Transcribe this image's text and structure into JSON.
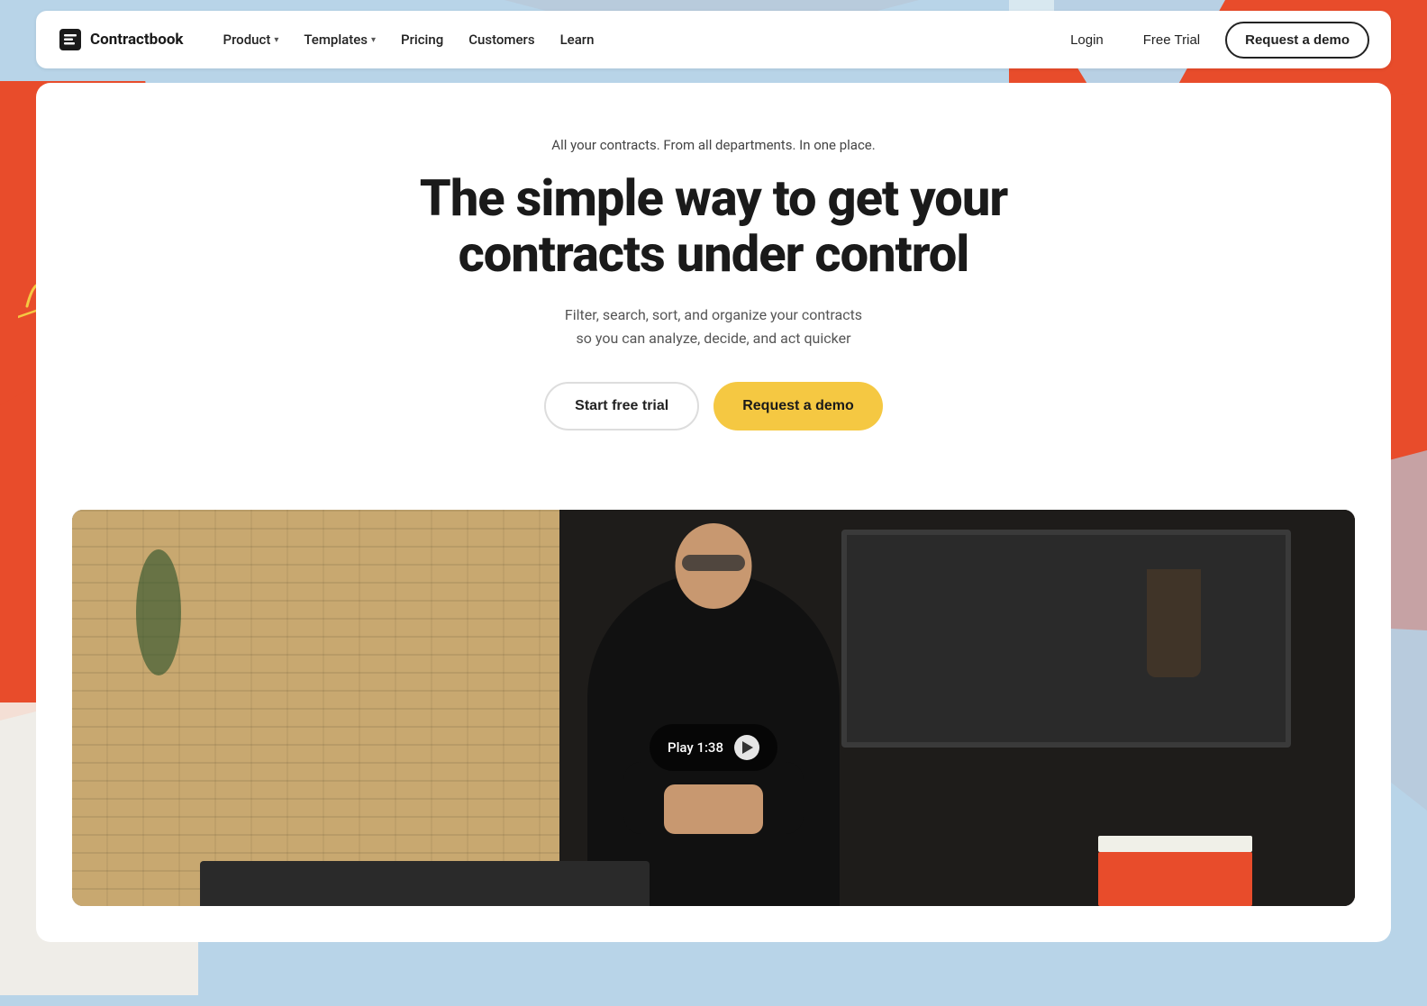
{
  "brand": {
    "name": "Contractbook",
    "logo_icon": "📋"
  },
  "navbar": {
    "nav_items": [
      {
        "label": "Product",
        "has_dropdown": true,
        "id": "product"
      },
      {
        "label": "Templates",
        "has_dropdown": true,
        "id": "templates"
      },
      {
        "label": "Pricing",
        "has_dropdown": false,
        "id": "pricing"
      },
      {
        "label": "Customers",
        "has_dropdown": false,
        "id": "customers"
      },
      {
        "label": "Learn",
        "has_dropdown": false,
        "id": "learn"
      }
    ],
    "login_label": "Login",
    "free_trial_label": "Free Trial",
    "request_demo_label": "Request a demo"
  },
  "hero": {
    "tagline": "All your contracts. From all departments. In one place.",
    "title_line1": "The simple way to get your",
    "title_line2": "contracts under control",
    "subtitle_line1": "Filter, search, sort, and organize your contracts",
    "subtitle_line2": "so you can analyze, decide, and act quicker",
    "btn_trial": "Start free trial",
    "btn_demo": "Request a demo"
  },
  "video": {
    "play_label": "Play 1:38",
    "duration": "1:38"
  },
  "colors": {
    "yellow": "#f5c842",
    "accent_red": "#e84c2b",
    "light_blue": "#b8d4e8",
    "dark": "#1a1a1a"
  }
}
